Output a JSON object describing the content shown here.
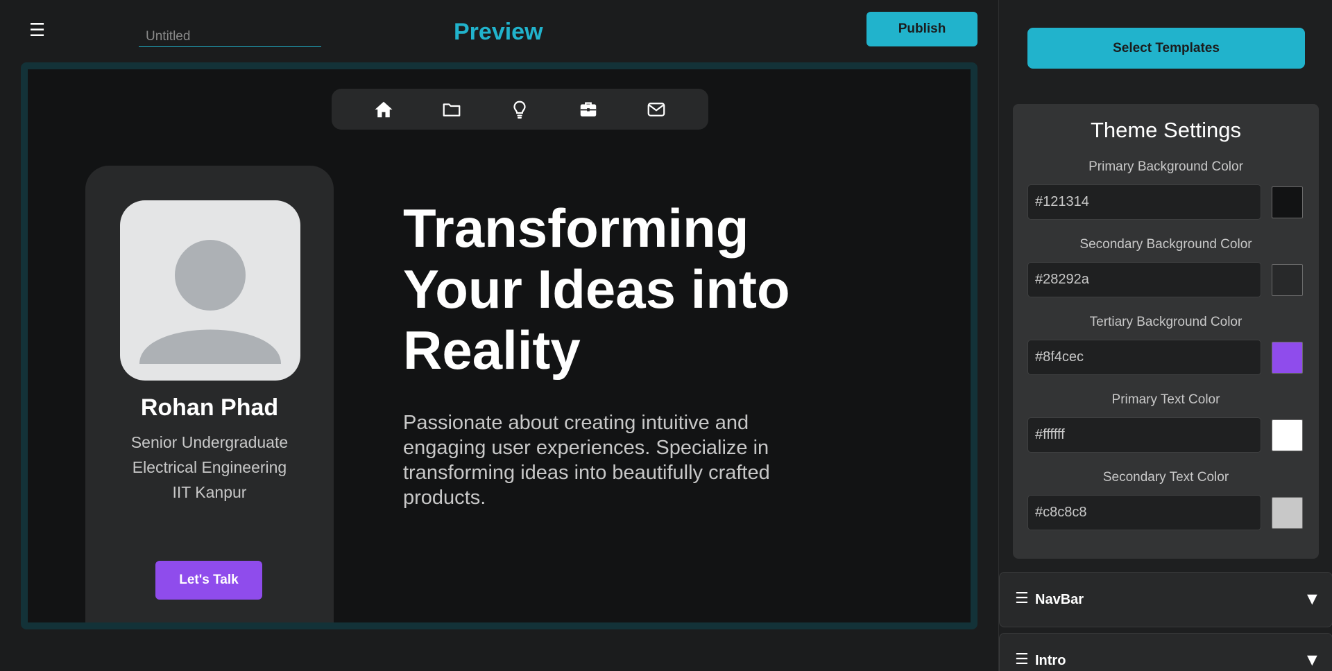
{
  "header": {
    "menu_icon": "hamburger-menu-icon",
    "menu_glyph": "☰",
    "title_placeholder": "Untitled",
    "preview_label": "Preview",
    "publish_label": "Publish"
  },
  "preview": {
    "nav_icons": [
      "home-icon",
      "folder-icon",
      "lightbulb-icon",
      "briefcase-icon",
      "mail-icon"
    ],
    "profile": {
      "name": "Rohan Phad",
      "line1": "Senior Undergraduate",
      "line2": "Electrical Engineering",
      "line3": "IIT Kanpur",
      "cta_label": "Let's Talk"
    },
    "hero": {
      "heading_line1": "Transforming",
      "heading_line2": "Your Ideas into",
      "heading_line3": "Reality",
      "subtitle": "Passionate about creating intuitive and engaging user experiences. Specialize in transforming ideas into beautifully crafted products."
    }
  },
  "sidebar": {
    "select_templates_label": "Select Templates",
    "theme": {
      "title": "Theme Settings",
      "colors": [
        {
          "label": "Primary Background Color",
          "value": "#121314"
        },
        {
          "label": "Secondary Background Color",
          "value": "#28292a"
        },
        {
          "label": "Tertiary Background Color",
          "value": "#8f4cec"
        },
        {
          "label": "Primary Text Color",
          "value": "#ffffff"
        },
        {
          "label": "Secondary Text Color",
          "value": "#c8c8c8"
        }
      ]
    },
    "sections": [
      {
        "label": "NavBar",
        "handle": "☰",
        "arrow": "▼"
      },
      {
        "label": "Intro",
        "handle": "☰",
        "arrow": "▼"
      }
    ]
  },
  "colors": {
    "accent": "#21b3cc",
    "brand_purple": "#8f4cec"
  }
}
